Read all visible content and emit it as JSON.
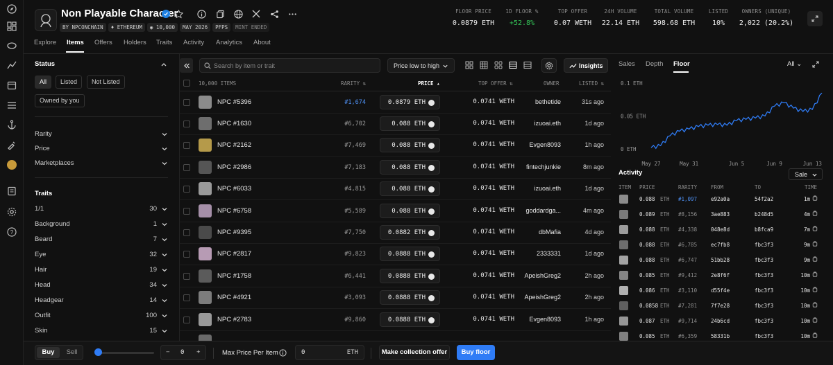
{
  "collection": {
    "title": "Non Playable Character",
    "tags": [
      "BY NPCONCHAIN",
      "ETHEREUM",
      "10,000",
      "MAY 2026",
      "PFPS",
      "MINT ENDED"
    ]
  },
  "stats": [
    {
      "label": "FLOOR PRICE",
      "value": "0.0879 ETH"
    },
    {
      "label": "1D FLOOR %",
      "value": "+52.8%"
    },
    {
      "label": "TOP OFFER",
      "value": "0.07 WETH"
    },
    {
      "label": "24H VOLUME",
      "value": "22.14 ETH"
    },
    {
      "label": "TOTAL VOLUME",
      "value": "598.68 ETH"
    },
    {
      "label": "LISTED",
      "value": "10%"
    },
    {
      "label": "OWNERS (UNIQUE)",
      "value": "2,022 (20.2%)"
    }
  ],
  "tabs": [
    "Explore",
    "Items",
    "Offers",
    "Holders",
    "Traits",
    "Activity",
    "Analytics",
    "About"
  ],
  "filters": {
    "status_title": "Status",
    "status_pills": [
      "All",
      "Listed",
      "Not Listed",
      "Owned by you"
    ],
    "sections": [
      "Rarity",
      "Price",
      "Marketplaces"
    ],
    "traits_title": "Traits",
    "traits": [
      {
        "name": "1/1",
        "count": "30"
      },
      {
        "name": "Background",
        "count": "1"
      },
      {
        "name": "Beard",
        "count": "7"
      },
      {
        "name": "Eye",
        "count": "32"
      },
      {
        "name": "Hair",
        "count": "19"
      },
      {
        "name": "Head",
        "count": "34"
      },
      {
        "name": "Headgear",
        "count": "14"
      },
      {
        "name": "Outfit",
        "count": "100"
      },
      {
        "name": "Skin",
        "count": "15"
      }
    ]
  },
  "toolbar": {
    "search_placeholder": "Search by item or trait",
    "sort_label": "Price low to high",
    "insights_label": "Insights"
  },
  "table": {
    "headers": {
      "items": "10,000 ITEMS",
      "rarity": "RARITY",
      "price": "PRICE",
      "top_offer": "TOP OFFER",
      "owner": "OWNER",
      "listed": "LISTED"
    },
    "rows": [
      {
        "name": "NPC #5396",
        "rarity": "#1,674",
        "price": "0.0879 ETH",
        "offer": "0.0741 WETH",
        "owner": "bethetide",
        "listed": "31s ago"
      },
      {
        "name": "NPC #1630",
        "rarity": "#6,702",
        "price": "0.088 ETH",
        "offer": "0.0741 WETH",
        "owner": "izuoai.eth",
        "listed": "1d ago"
      },
      {
        "name": "NPC #2162",
        "rarity": "#7,469",
        "price": "0.088 ETH",
        "offer": "0.0741 WETH",
        "owner": "Evgen8093",
        "listed": "1h ago"
      },
      {
        "name": "NPC #2986",
        "rarity": "#7,183",
        "price": "0.088 ETH",
        "offer": "0.0741 WETH",
        "owner": "fintechjunkie",
        "listed": "8m ago"
      },
      {
        "name": "NPC #6033",
        "rarity": "#4,815",
        "price": "0.088 ETH",
        "offer": "0.0741 WETH",
        "owner": "izuoai.eth",
        "listed": "1d ago"
      },
      {
        "name": "NPC #6758",
        "rarity": "#5,589",
        "price": "0.088 ETH",
        "offer": "0.0741 WETH",
        "owner": "goddardga...",
        "listed": "4m ago"
      },
      {
        "name": "NPC #9395",
        "rarity": "#7,750",
        "price": "0.0882 ETH",
        "offer": "0.0741 WETH",
        "owner": "dbMafia",
        "listed": "4d ago"
      },
      {
        "name": "NPC #2817",
        "rarity": "#9,823",
        "price": "0.0888 ETH",
        "offer": "0.0741 WETH",
        "owner": "2333331",
        "listed": "1d ago"
      },
      {
        "name": "NPC #1758",
        "rarity": "#6,441",
        "price": "0.0888 ETH",
        "offer": "0.0741 WETH",
        "owner": "ApeishGreg2",
        "listed": "2h ago"
      },
      {
        "name": "NPC #4921",
        "rarity": "#3,093",
        "price": "0.0888 ETH",
        "offer": "0.0741 WETH",
        "owner": "ApeishGreg2",
        "listed": "2h ago"
      },
      {
        "name": "NPC #2783",
        "rarity": "#9,860",
        "price": "0.0888 ETH",
        "offer": "0.0741 WETH",
        "owner": "Evgen8093",
        "listed": "1h ago"
      }
    ]
  },
  "right_panel": {
    "tabs": [
      "Sales",
      "Depth",
      "Floor"
    ],
    "range_label": "All",
    "activity_title": "Activity",
    "activity_filter": "Sale",
    "activity_headers": [
      "ITEM",
      "PRICE",
      "RARITY",
      "FROM",
      "TO",
      "TIME"
    ],
    "activity": [
      {
        "price": "0.088",
        "rarity": "#1,097",
        "from": "e92a0a",
        "to": "54f2a2",
        "time": "1m"
      },
      {
        "price": "0.089",
        "rarity": "#8,156",
        "from": "3ae883",
        "to": "b248d5",
        "time": "4m"
      },
      {
        "price": "0.088",
        "rarity": "#4,338",
        "from": "048e8d",
        "to": "b8fca9",
        "time": "7m"
      },
      {
        "price": "0.088",
        "rarity": "#6,785",
        "from": "ec7fb8",
        "to": "fbc3f3",
        "time": "9m"
      },
      {
        "price": "0.088",
        "rarity": "#6,747",
        "from": "51bb28",
        "to": "fbc3f3",
        "time": "9m"
      },
      {
        "price": "0.085",
        "rarity": "#9,412",
        "from": "2e8f6f",
        "to": "fbc3f3",
        "time": "10m"
      },
      {
        "price": "0.086",
        "rarity": "#3,110",
        "from": "d55f4e",
        "to": "fbc3f3",
        "time": "10m"
      },
      {
        "price": "0.0858",
        "rarity": "#7,281",
        "from": "7f7e28",
        "to": "fbc3f3",
        "time": "10m"
      },
      {
        "price": "0.087",
        "rarity": "#9,714",
        "from": "24b6cd",
        "to": "fbc3f3",
        "time": "10m"
      },
      {
        "price": "0.085",
        "rarity": "#6,359",
        "from": "58331b",
        "to": "fbc3f3",
        "time": "10m"
      }
    ],
    "currency": "ETH"
  },
  "chart_data": {
    "type": "line",
    "title": "",
    "ylabel": "",
    "ylim": [
      0,
      0.1
    ],
    "y_ticks": [
      "0.1 ETH",
      "0.05 ETH",
      "0 ETH"
    ],
    "x_ticks": [
      "May 27",
      "May 31",
      "Jun 5",
      "Jun 9",
      "Jun 13"
    ],
    "series": [
      {
        "x": [
          "May 27",
          "May 28",
          "May 29",
          "May 30",
          "May 31",
          "Jun 1",
          "Jun 2",
          "Jun 3",
          "Jun 4",
          "Jun 5",
          "Jun 6",
          "Jun 7",
          "Jun 8",
          "Jun 9",
          "Jun 10",
          "Jun 11",
          "Jun 12",
          "Jun 13",
          "Jun 14"
        ],
        "values": [
          0.002,
          0.005,
          0.02,
          0.027,
          0.03,
          0.034,
          0.036,
          0.037,
          0.036,
          0.043,
          0.045,
          0.047,
          0.05,
          0.065,
          0.07,
          0.062,
          0.057,
          0.06,
          0.085
        ]
      }
    ],
    "grid": false,
    "color": "#2f7cf6"
  },
  "bottom_bar": {
    "buy": "Buy",
    "sell": "Sell",
    "quantity": "0",
    "max_price_label": "Max Price Per Item",
    "max_price_value": "0",
    "currency": "ETH",
    "collection_offer": "Make collection offer",
    "buy_floor": "Buy floor"
  },
  "colors": {
    "accent": "#2f7cf6",
    "positive": "#34c759",
    "rarity_highlight": "#4d8ef0"
  }
}
